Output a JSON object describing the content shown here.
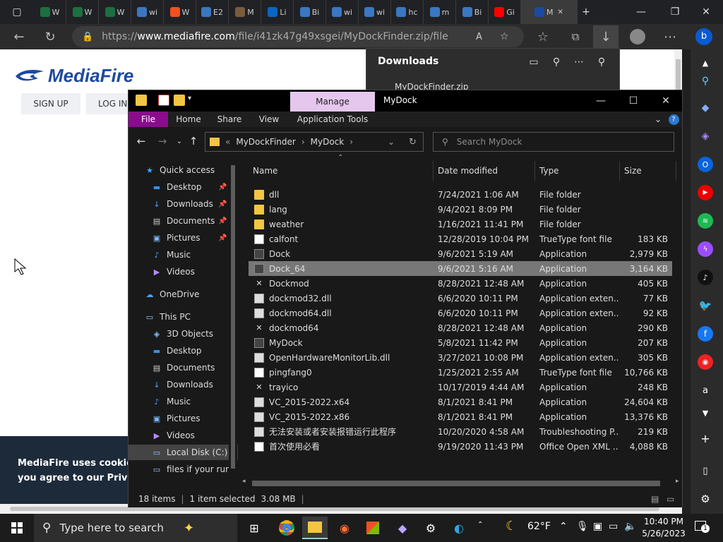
{
  "browser": {
    "tabs": [
      {
        "label": "W",
        "color": "#1d6f42"
      },
      {
        "label": "W",
        "color": "#1d6f42"
      },
      {
        "label": "W",
        "color": "#1d6f42"
      },
      {
        "label": "wi",
        "color": "#3b77c2"
      },
      {
        "label": "W",
        "color": "#f25022"
      },
      {
        "label": "E2",
        "color": "#3b77c2"
      },
      {
        "label": "M",
        "color": "#7a5c3d"
      },
      {
        "label": "Li",
        "color": "#0a66c2"
      },
      {
        "label": "Bi",
        "color": "#3b77c2"
      },
      {
        "label": "wi",
        "color": "#3b77c2"
      },
      {
        "label": "wi",
        "color": "#3b77c2"
      },
      {
        "label": "hc",
        "color": "#3b77c2"
      },
      {
        "label": "m",
        "color": "#3b77c2"
      },
      {
        "label": "Bi",
        "color": "#3b77c2"
      },
      {
        "label": "Gi",
        "color": "#ff0000"
      },
      {
        "label": "M",
        "color": "#1c4aa0"
      }
    ],
    "url_prefix": "https://",
    "url_host": "www.mediafire.com",
    "url_path": "/file/i41zk47g49xsgei/MyDockFinder.zip/file",
    "downloads_title": "Downloads",
    "download_item": "MyDockFinder.zip"
  },
  "webpage": {
    "logo": "MediaFire",
    "signup": "SIGN UP",
    "login": "LOG IN",
    "cookie_line1": "MediaFire uses cookies to p",
    "cookie_line2": "you agree to our Privacy Po"
  },
  "explorer": {
    "title": "MyDock",
    "manage_tab": "Manage",
    "ribbon": {
      "file": "File",
      "home": "Home",
      "share": "Share",
      "view": "View",
      "app_tools": "Application Tools"
    },
    "breadcrumb": {
      "prefix": "«",
      "part1": "MyDockFinder",
      "part2": "MyDock"
    },
    "search_placeholder": "Search MyDock",
    "columns": {
      "name": "Name",
      "date": "Date modified",
      "type": "Type",
      "size": "Size"
    },
    "nav": [
      {
        "label": "Quick access",
        "icon": "★",
        "indent": 0,
        "pin": false
      },
      {
        "label": "Desktop",
        "icon": "▬",
        "indent": 1,
        "pin": true
      },
      {
        "label": "Downloads",
        "icon": "↓",
        "indent": 1,
        "pin": true
      },
      {
        "label": "Documents",
        "icon": "▤",
        "indent": 1,
        "pin": true
      },
      {
        "label": "Pictures",
        "icon": "▣",
        "indent": 1,
        "pin": true
      },
      {
        "label": "Music",
        "icon": "♪",
        "indent": 1,
        "pin": false
      },
      {
        "label": "Videos",
        "icon": "▶",
        "indent": 1,
        "pin": false
      },
      {
        "label": "OneDrive",
        "icon": "☁",
        "indent": 0,
        "pin": false
      },
      {
        "label": "This PC",
        "icon": "▭",
        "indent": 0,
        "pin": false
      },
      {
        "label": "3D Objects",
        "icon": "◈",
        "indent": 1,
        "pin": false
      },
      {
        "label": "Desktop",
        "icon": "▬",
        "indent": 1,
        "pin": false
      },
      {
        "label": "Documents",
        "icon": "▤",
        "indent": 1,
        "pin": false
      },
      {
        "label": "Downloads",
        "icon": "↓",
        "indent": 1,
        "pin": false
      },
      {
        "label": "Music",
        "icon": "♪",
        "indent": 1,
        "pin": false
      },
      {
        "label": "Pictures",
        "icon": "▣",
        "indent": 1,
        "pin": false
      },
      {
        "label": "Videos",
        "icon": "▶",
        "indent": 1,
        "pin": false
      },
      {
        "label": "Local Disk (C:)",
        "icon": "▭",
        "indent": 1,
        "pin": false,
        "selected": true
      },
      {
        "label": "files if your runn",
        "icon": "▭",
        "indent": 1,
        "pin": false
      }
    ],
    "files": [
      {
        "name": "dll",
        "date": "7/24/2021 1:06 AM",
        "type": "File folder",
        "size": "",
        "icon": "folder"
      },
      {
        "name": "lang",
        "date": "9/4/2021 8:09 PM",
        "type": "File folder",
        "size": "",
        "icon": "folder"
      },
      {
        "name": "weather",
        "date": "1/16/2021 11:41 PM",
        "type": "File folder",
        "size": "",
        "icon": "folder"
      },
      {
        "name": "calfont",
        "date": "12/28/2019 10:04 PM",
        "type": "TrueType font file",
        "size": "183 KB",
        "icon": "font"
      },
      {
        "name": "Dock",
        "date": "9/6/2021 5:19 AM",
        "type": "Application",
        "size": "2,979 KB",
        "icon": "app"
      },
      {
        "name": "Dock_64",
        "date": "9/6/2021 5:16 AM",
        "type": "Application",
        "size": "3,164 KB",
        "icon": "app",
        "selected": true
      },
      {
        "name": "Dockmod",
        "date": "8/28/2021 12:48 AM",
        "type": "Application",
        "size": "405 KB",
        "icon": "tool"
      },
      {
        "name": "dockmod32.dll",
        "date": "6/6/2020 10:11 PM",
        "type": "Application exten...",
        "size": "77 KB",
        "icon": "dll"
      },
      {
        "name": "dockmod64.dll",
        "date": "6/6/2020 10:11 PM",
        "type": "Application exten...",
        "size": "92 KB",
        "icon": "dll"
      },
      {
        "name": "dockmod64",
        "date": "8/28/2021 12:48 AM",
        "type": "Application",
        "size": "290 KB",
        "icon": "tool"
      },
      {
        "name": "MyDock",
        "date": "5/8/2021 11:42 PM",
        "type": "Application",
        "size": "207 KB",
        "icon": "app"
      },
      {
        "name": "OpenHardwareMonitorLib.dll",
        "date": "3/27/2021 10:08 PM",
        "type": "Application exten...",
        "size": "305 KB",
        "icon": "dll"
      },
      {
        "name": "pingfang0",
        "date": "1/25/2021 2:55 AM",
        "type": "TrueType font file",
        "size": "10,766 KB",
        "icon": "font"
      },
      {
        "name": "trayico",
        "date": "10/17/2019 4:44 AM",
        "type": "Application",
        "size": "248 KB",
        "icon": "tool"
      },
      {
        "name": "VC_2015-2022.x64",
        "date": "8/1/2021 8:41 PM",
        "type": "Application",
        "size": "24,604 KB",
        "icon": "dll"
      },
      {
        "name": "VC_2015-2022.x86",
        "date": "8/1/2021 8:41 PM",
        "type": "Application",
        "size": "13,376 KB",
        "icon": "dll"
      },
      {
        "name": "无法安装或者安装报错运行此程序",
        "date": "10/20/2020 4:58 AM",
        "type": "Troubleshooting P...",
        "size": "219 KB",
        "icon": "dll"
      },
      {
        "name": "首次使用必看",
        "date": "9/19/2020 11:43 PM",
        "type": "Office Open XML ...",
        "size": "4,088 KB",
        "icon": "doc"
      }
    ],
    "status": {
      "count": "18 items",
      "selected": "1 item selected",
      "size": "3.08 MB"
    }
  },
  "taskbar": {
    "search_placeholder": "Type here to search",
    "weather": "62°F",
    "time": "10:40 PM",
    "date": "5/26/2023",
    "notifications": "1"
  }
}
